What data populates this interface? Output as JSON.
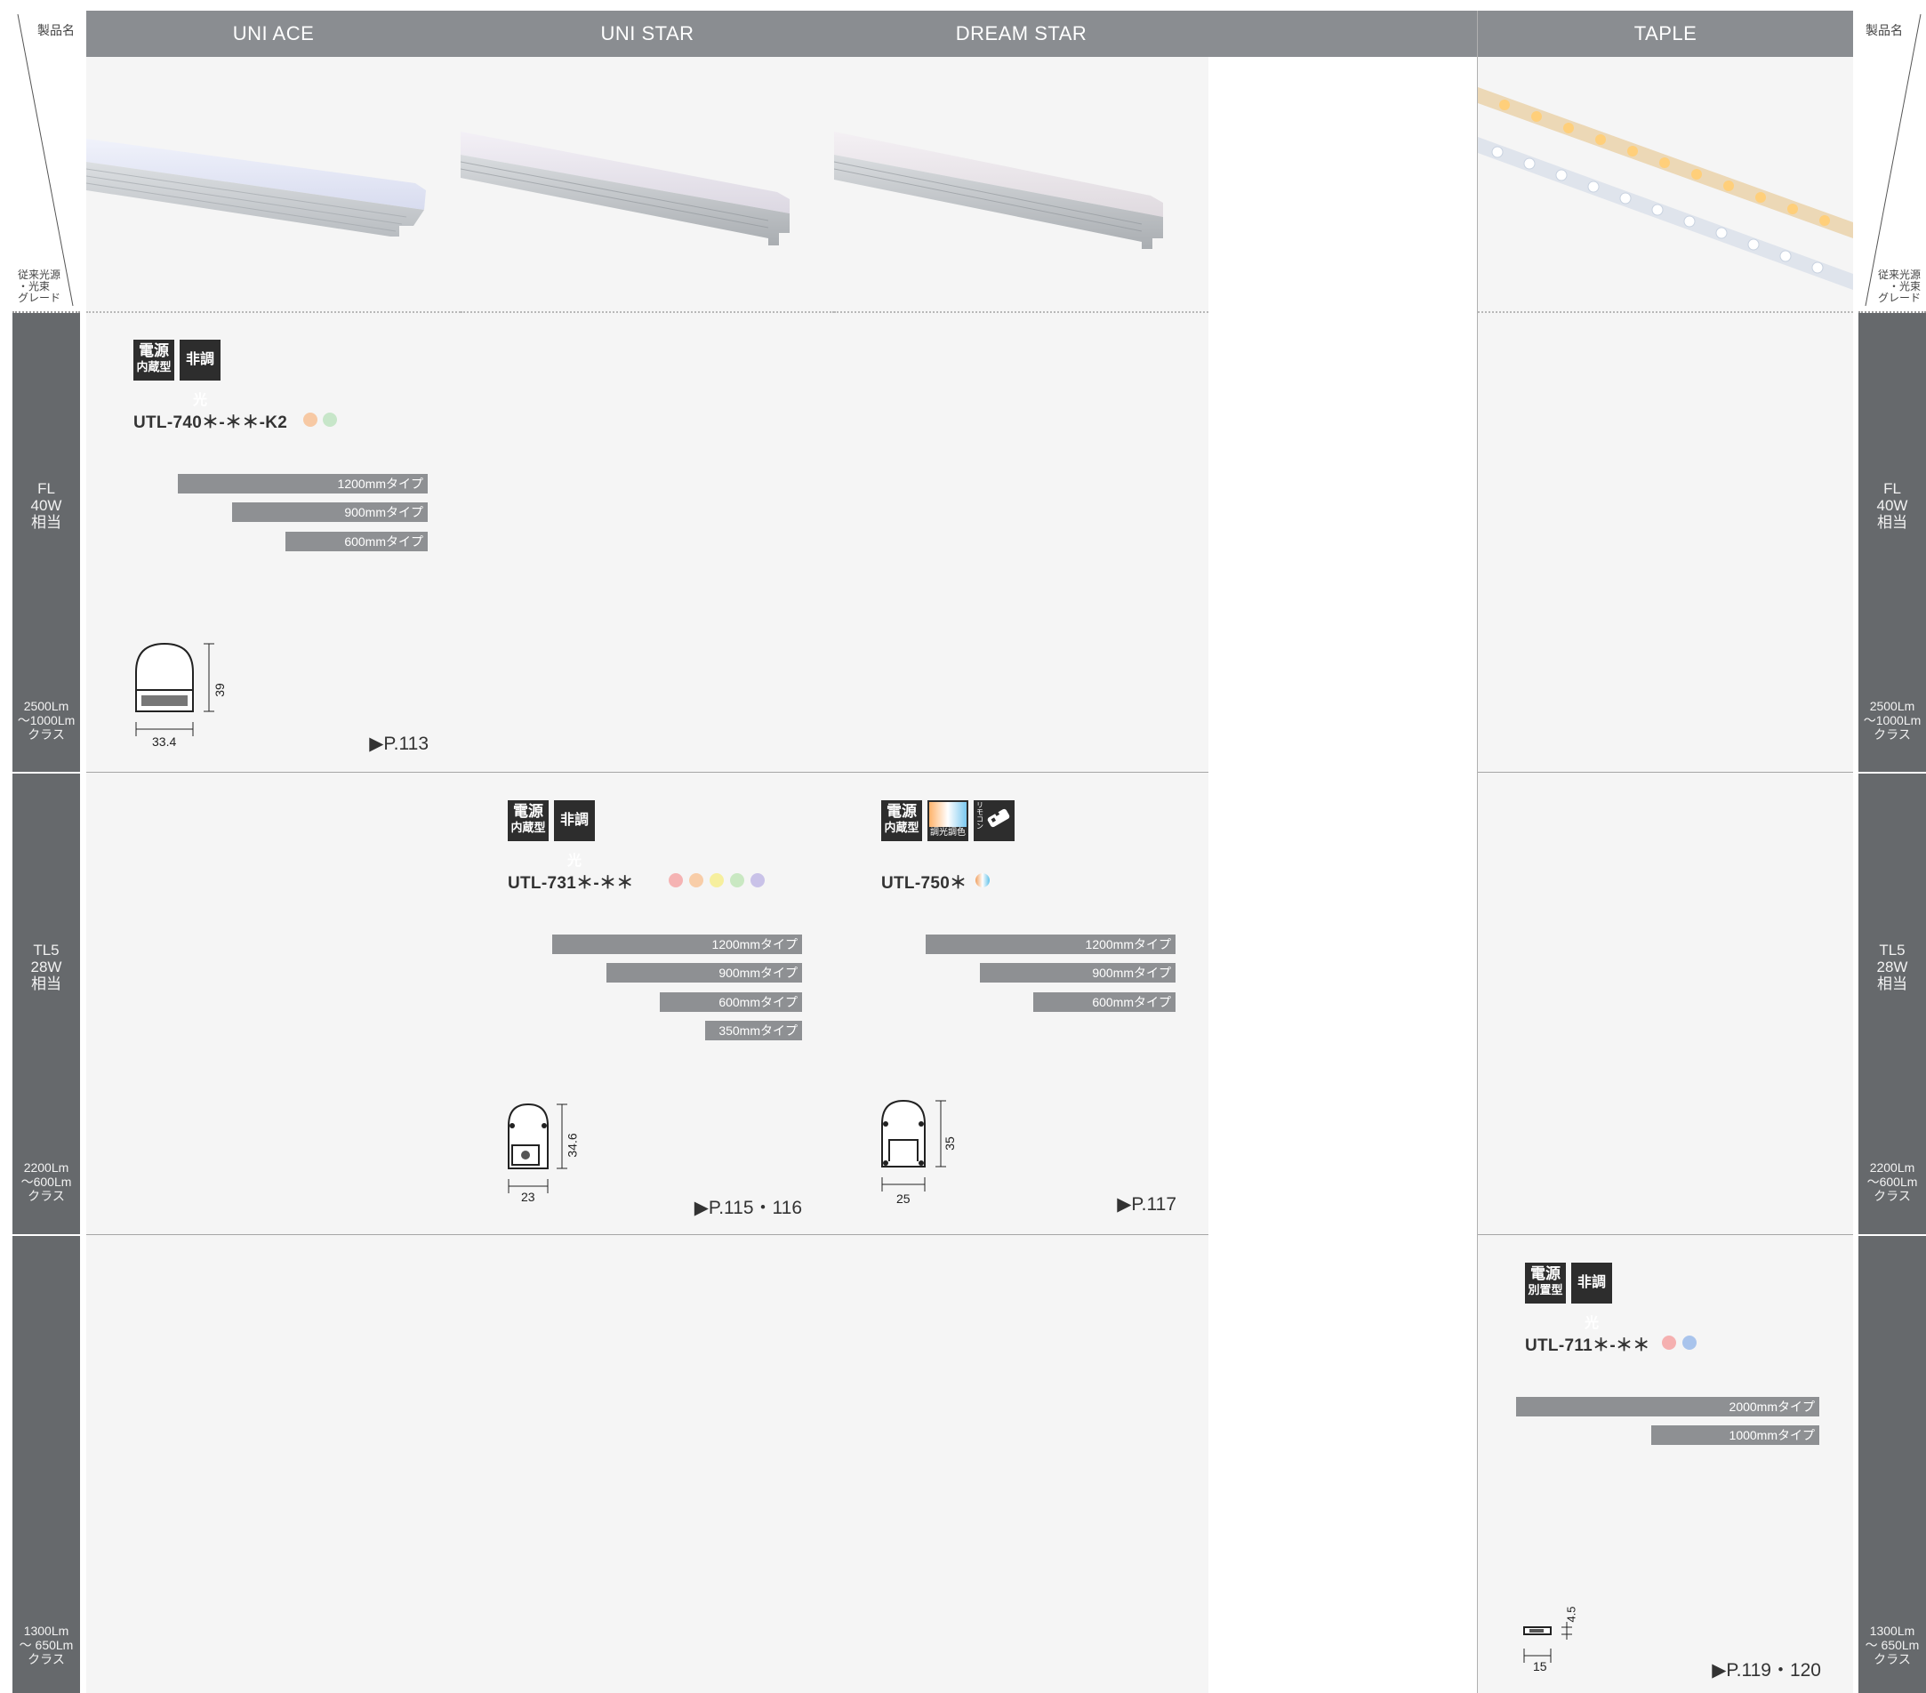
{
  "side": {
    "product_name": "製品名",
    "grade_label": [
      "従来光源",
      "・光束",
      "グレード"
    ],
    "rows": [
      {
        "type": [
          "FL",
          "40W",
          "相当"
        ],
        "lumen": [
          "2500Lm",
          "～1000Lm",
          "クラス"
        ]
      },
      {
        "type": [
          "TL5",
          "28W",
          "相当"
        ],
        "lumen": [
          "2200Lm",
          "～600Lm",
          "クラス"
        ]
      },
      {
        "type": [],
        "lumen": [
          "1300Lm",
          "～ 650Lm",
          "クラス"
        ]
      }
    ]
  },
  "columns": [
    {
      "name": "UNI ACE"
    },
    {
      "name": "UNI STAR"
    },
    {
      "name": "DREAM STAR"
    },
    {
      "name": ""
    },
    {
      "name": "TAPLE"
    }
  ],
  "products": {
    "uni_ace": {
      "badge_power": [
        "電源",
        "内蔵型"
      ],
      "badge_dim": "非調光",
      "model": "UTL-740＊-＊＊-K2",
      "color_dots": [
        "#f7c9a4",
        "#c7e6c9"
      ],
      "types": [
        "1200mmタイプ",
        "900mmタイプ",
        "600mmタイプ"
      ],
      "dim_width": "33.4",
      "dim_height": "39",
      "page": "▶P.113"
    },
    "uni_star": {
      "badge_power": [
        "電源",
        "内蔵型"
      ],
      "badge_dim": "非調光",
      "model": "UTL-731＊-＊＊",
      "color_dots": [
        "#f5b3b3",
        "#f8cda8",
        "#f6ef9e",
        "#c9e8c2",
        "#c9c2e8"
      ],
      "types": [
        "1200mmタイプ",
        "900mmタイプ",
        "600mmタイプ",
        "350mmタイプ"
      ],
      "dim_width": "23",
      "dim_height": "34.6",
      "page": "▶P.115・116"
    },
    "dream_star": {
      "badge_power": [
        "電源",
        "内蔵型"
      ],
      "badge_tunable": "調光調色",
      "badge_remote": "リモコン",
      "model": "UTL-750＊",
      "color_dots": [
        "#f0a060"
      ],
      "types": [
        "1200mmタイプ",
        "900mmタイプ",
        "600mmタイプ"
      ],
      "dim_width": "25",
      "dim_height": "35",
      "page": "▶P.117"
    },
    "taple": {
      "badge_power": [
        "電源",
        "別置型"
      ],
      "badge_dim": "非調光",
      "model": "UTL-711＊-＊＊",
      "color_dots": [
        "#f5b0b0",
        "#a9c4ec"
      ],
      "types": [
        "2000mmタイプ",
        "1000mmタイプ"
      ],
      "dim_width": "15",
      "dim_height": "4.5",
      "page": "▶P.119・120"
    }
  }
}
